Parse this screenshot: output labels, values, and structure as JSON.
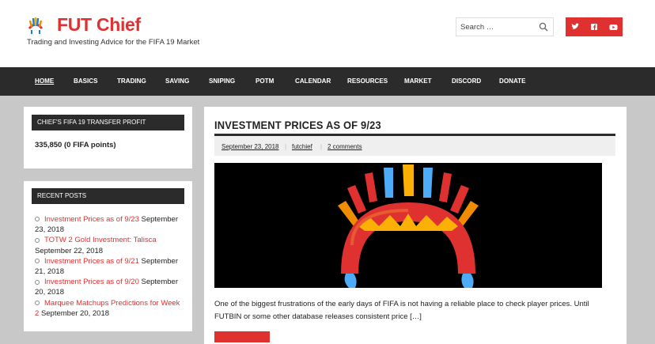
{
  "header": {
    "title": "FUT Chief",
    "tagline": "Trading and Investing Advice for the FIFA 19 Market",
    "search_placeholder": "Search …",
    "social": [
      "twitter-icon",
      "facebook-icon",
      "youtube-icon"
    ]
  },
  "nav": {
    "items": [
      "HOME",
      "BASICS",
      "TRADING",
      "SAVING",
      "SNIPING",
      "POTM",
      "CALENDAR",
      "RESOURCES",
      "MARKET",
      "DISCORD",
      "DONATE"
    ]
  },
  "sidebar": {
    "profit_title": "CHIEF'S FIFA 19 TRANSFER PROFIT",
    "profit_value": "335,850 (0 FIFA points)",
    "recent_title": "RECENT POSTS",
    "posts": [
      {
        "title": "Investment Prices as of 9/23",
        "date": "September 23, 2018"
      },
      {
        "title": "TOTW 2 Gold Investment: Talisca",
        "date": "September 22, 2018"
      },
      {
        "title": "Investment Prices as of 9/21",
        "date": "September 21, 2018"
      },
      {
        "title": "Investment Prices as of 9/20",
        "date": "September 20, 2018"
      },
      {
        "title": "Marquee Matchups Predictions for Week 2",
        "date": "September 20, 2018"
      }
    ]
  },
  "article": {
    "title": "INVESTMENT PRICES AS OF 9/23",
    "date": "September 23, 2018",
    "author": "futchief",
    "comments": "2 comments",
    "excerpt": "One of the biggest frustrations of the early days of FIFA is not having a reliable place to check player prices. Until FUTBIN or some other database releases consistent price […]"
  },
  "colors": {
    "accent": "#e03131",
    "nav_bg": "#2b2b2b",
    "page_bg": "#c8c8c8"
  }
}
